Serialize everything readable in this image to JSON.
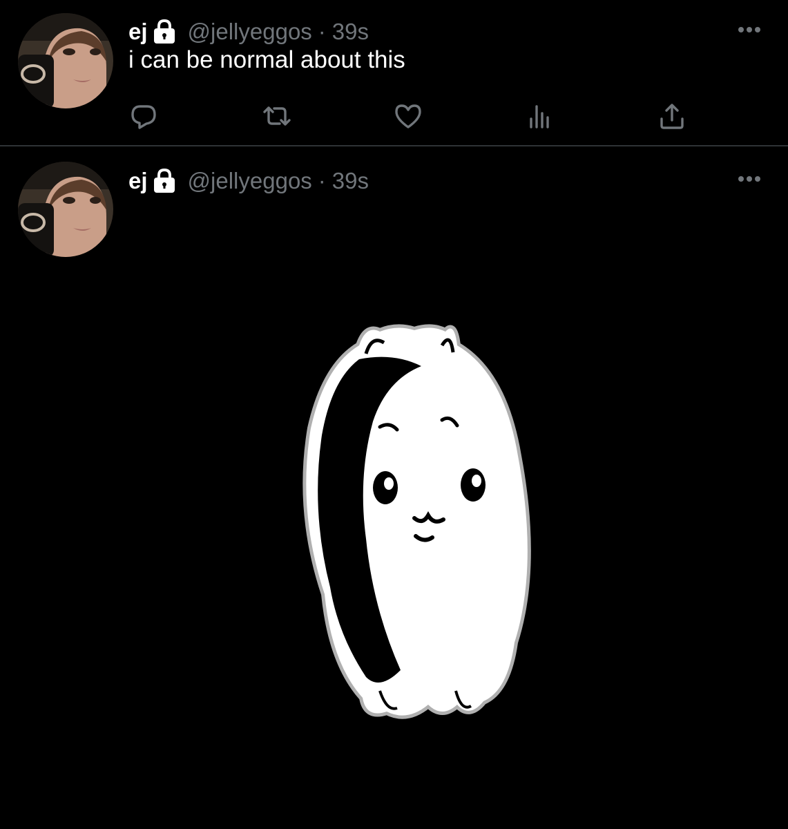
{
  "tweets": [
    {
      "display_name": "ej",
      "handle": "@jellyeggos",
      "separator": "·",
      "time": "39s",
      "text": "i can be normal about this",
      "protected": true,
      "actions": [
        "reply-icon",
        "retweet-icon",
        "like-icon",
        "views-icon",
        "share-icon"
      ]
    },
    {
      "display_name": "ej",
      "handle": "@jellyeggos",
      "separator": "·",
      "time": "39s",
      "protected": true,
      "media": "sad-cartoon-creature-image"
    }
  ],
  "colors": {
    "background": "#000000",
    "primary_text": "#ffffff",
    "secondary_text": "#71767b",
    "divider": "#2f3336"
  }
}
